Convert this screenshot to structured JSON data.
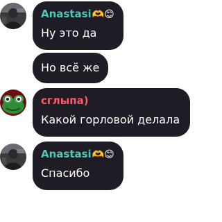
{
  "messages": [
    {
      "author": "Anastasi",
      "author_emoji": "🫶😊",
      "author_color": "#4fc9b4",
      "text": "Ну это да",
      "avatar": "person-dark-photo-avatar"
    },
    {
      "text": "Но всё же"
    },
    {
      "author": "сглыпа)",
      "author_color": "#ff5a6a",
      "text": "Какой горловой делала",
      "avatar": "frog-avatar"
    },
    {
      "author": "Anastasi",
      "author_emoji": "🫶😊",
      "author_color": "#4fc9b4",
      "text": "Спасибо",
      "avatar": "person-dark-photo-avatar"
    }
  ],
  "colors": {
    "bubble": "#1f1c26",
    "text": "#ffffff",
    "background": "#ffffff"
  }
}
